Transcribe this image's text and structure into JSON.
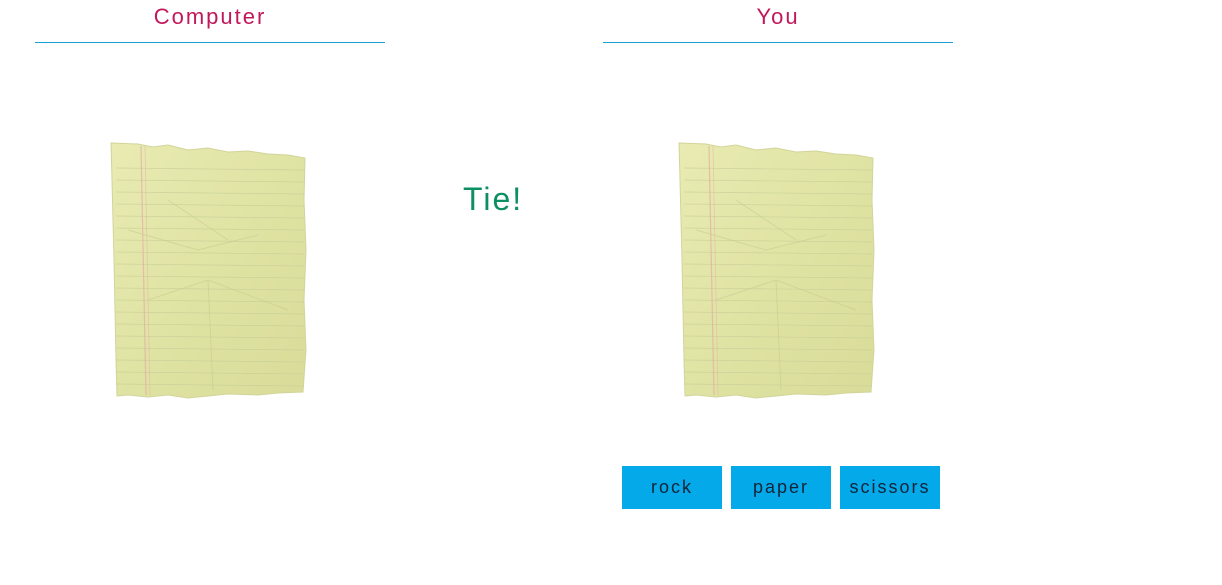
{
  "computer": {
    "title": "Computer",
    "choice": "paper"
  },
  "player": {
    "title": "You",
    "choice": "paper"
  },
  "result": {
    "text": "Tie!"
  },
  "buttons": {
    "rock_label": "rock",
    "paper_label": "paper",
    "scissors_label": "scissors"
  },
  "colors": {
    "title": "#c2185b",
    "rule": "#1a9fd6",
    "result": "#0b8f63",
    "button_bg": "#03a9e8",
    "button_text": "#14233a",
    "paper": "#e3e6a6"
  }
}
